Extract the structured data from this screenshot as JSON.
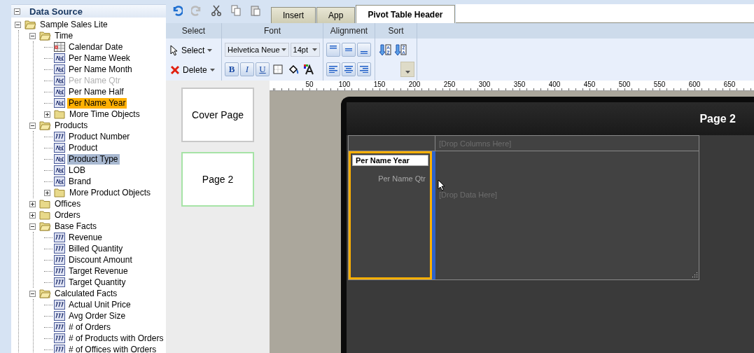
{
  "panel": {
    "title": "Data Source"
  },
  "tree": [
    {
      "label": "Sample Sales Lite",
      "kind": "folder",
      "expanded": true,
      "selected": false,
      "children": [
        {
          "label": "Time",
          "kind": "folder",
          "expanded": true,
          "selected": false,
          "children": [
            {
              "label": "Calendar Date",
              "kind": "date",
              "selected": false,
              "disabled": false,
              "dragging": false
            },
            {
              "label": "Per Name Week",
              "kind": "text",
              "selected": false,
              "disabled": false,
              "dragging": false
            },
            {
              "label": "Per Name Month",
              "kind": "text",
              "selected": false,
              "disabled": false,
              "dragging": false
            },
            {
              "label": "Per Name Qtr",
              "kind": "text",
              "selected": false,
              "disabled": true,
              "dragging": false
            },
            {
              "label": "Per Name Half",
              "kind": "text",
              "selected": false,
              "disabled": false,
              "dragging": false
            },
            {
              "label": "Per Name Year",
              "kind": "text",
              "selected": false,
              "disabled": false,
              "dragging": true
            },
            {
              "label": "More Time Objects",
              "kind": "folder",
              "expanded": false,
              "selected": false
            }
          ]
        },
        {
          "label": "Products",
          "kind": "folder",
          "expanded": true,
          "selected": false,
          "children": [
            {
              "label": "Product Number",
              "kind": "number",
              "selected": false,
              "disabled": false,
              "dragging": false
            },
            {
              "label": "Product",
              "kind": "text",
              "selected": false,
              "disabled": false,
              "dragging": false
            },
            {
              "label": "Product Type",
              "kind": "text",
              "selected": true,
              "disabled": false,
              "dragging": false
            },
            {
              "label": "LOB",
              "kind": "text",
              "selected": false,
              "disabled": false,
              "dragging": false
            },
            {
              "label": "Brand",
              "kind": "text",
              "selected": false,
              "disabled": false,
              "dragging": false
            },
            {
              "label": "More Product Objects",
              "kind": "folder",
              "expanded": false,
              "selected": false
            }
          ]
        },
        {
          "label": "Offices",
          "kind": "folder",
          "expanded": false,
          "selected": false
        },
        {
          "label": "Orders",
          "kind": "folder",
          "expanded": false,
          "selected": false
        },
        {
          "label": "Base Facts",
          "kind": "folder",
          "expanded": true,
          "selected": false,
          "children": [
            {
              "label": "Revenue",
              "kind": "number",
              "selected": false,
              "disabled": false,
              "dragging": false
            },
            {
              "label": "Billed Quantity",
              "kind": "number",
              "selected": false,
              "disabled": false,
              "dragging": false
            },
            {
              "label": "Discount Amount",
              "kind": "number",
              "selected": false,
              "disabled": false,
              "dragging": false
            },
            {
              "label": "Target Revenue",
              "kind": "number",
              "selected": false,
              "disabled": false,
              "dragging": false
            },
            {
              "label": "Target Quantity",
              "kind": "number",
              "selected": false,
              "disabled": false,
              "dragging": false
            }
          ]
        },
        {
          "label": "Calculated Facts",
          "kind": "folder",
          "expanded": true,
          "selected": false,
          "children": [
            {
              "label": "Actual Unit Price",
              "kind": "number",
              "selected": false,
              "disabled": false,
              "dragging": false
            },
            {
              "label": "Avg Order Size",
              "kind": "number",
              "selected": false,
              "disabled": false,
              "dragging": false
            },
            {
              "label": "# of Orders",
              "kind": "number",
              "selected": false,
              "disabled": false,
              "dragging": false
            },
            {
              "label": "# of Products with Orders",
              "kind": "number",
              "selected": false,
              "disabled": false,
              "dragging": false
            },
            {
              "label": "# of Offices with Orders",
              "kind": "number",
              "selected": false,
              "disabled": false,
              "dragging": false
            }
          ]
        }
      ]
    }
  ],
  "tabs": [
    {
      "label": "Insert",
      "selected": false
    },
    {
      "label": "App",
      "selected": false
    },
    {
      "label": "Pivot Table Header",
      "selected": true
    }
  ],
  "ribbon": {
    "groups": [
      "Select",
      "Font",
      "Alignment",
      "Sort"
    ],
    "select_label": "Select",
    "delete_label": "Delete",
    "font_family": "Helvetica Neue",
    "font_size": "14pt",
    "format_buttons": [
      "B",
      "I",
      "U"
    ]
  },
  "pages": [
    {
      "label": "Cover Page",
      "selected": false
    },
    {
      "label": "Page 2",
      "selected": true
    }
  ],
  "ruler": [
    "50",
    "100",
    "150",
    "200",
    "250",
    "300",
    "350",
    "400",
    "450",
    "500",
    "550",
    "600",
    "650"
  ],
  "canvas": {
    "page_title": "Page 2",
    "columns_placeholder": "[Drop Columns Here]",
    "row_field": "Per Name Year",
    "drag_label": "Per Name Qtr",
    "data_placeholder": "[Drop Data Here]"
  }
}
